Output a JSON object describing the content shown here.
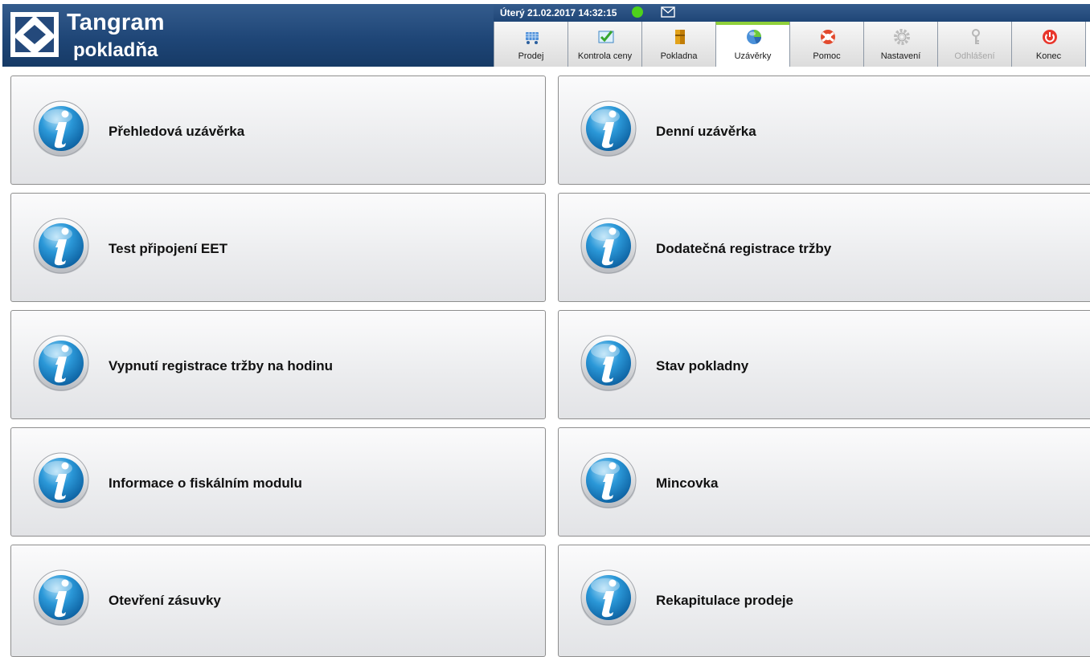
{
  "header": {
    "brand_title": "Tangram",
    "brand_subtitle": "pokladňa",
    "datetime": "Úterý 21.02.2017 14:32:15",
    "status_color": "#4ed21b",
    "brand_color": "#1f4677",
    "active_tab_accent": "#8fd03a"
  },
  "tabs": [
    {
      "label": "Prodej",
      "icon": "cart-icon"
    },
    {
      "label": "Kontrola ceny",
      "icon": "price-check-icon"
    },
    {
      "label": "Pokladna",
      "icon": "cash-register-icon"
    },
    {
      "label": "Uzávěrky",
      "icon": "pie-chart-icon",
      "active": true
    },
    {
      "label": "Pomoc",
      "icon": "lifebuoy-icon"
    },
    {
      "label": "Nastavení",
      "icon": "gear-icon"
    },
    {
      "label": "Odhlášení",
      "icon": "key-icon",
      "disabled": true
    },
    {
      "label": "Konec",
      "icon": "power-icon"
    }
  ],
  "tiles": [
    {
      "label": "Přehledová uzávěrka"
    },
    {
      "label": "Denní uzávěrka"
    },
    {
      "label": "Test připojení EET"
    },
    {
      "label": "Dodatečná registrace tržby"
    },
    {
      "label": "Vypnutí registrace tržby na hodinu"
    },
    {
      "label": "Stav pokladny"
    },
    {
      "label": "Informace o fiskálním modulu"
    },
    {
      "label": "Mincovka"
    },
    {
      "label": "Otevření zásuvky"
    },
    {
      "label": "Rekapitulace prodeje"
    }
  ]
}
